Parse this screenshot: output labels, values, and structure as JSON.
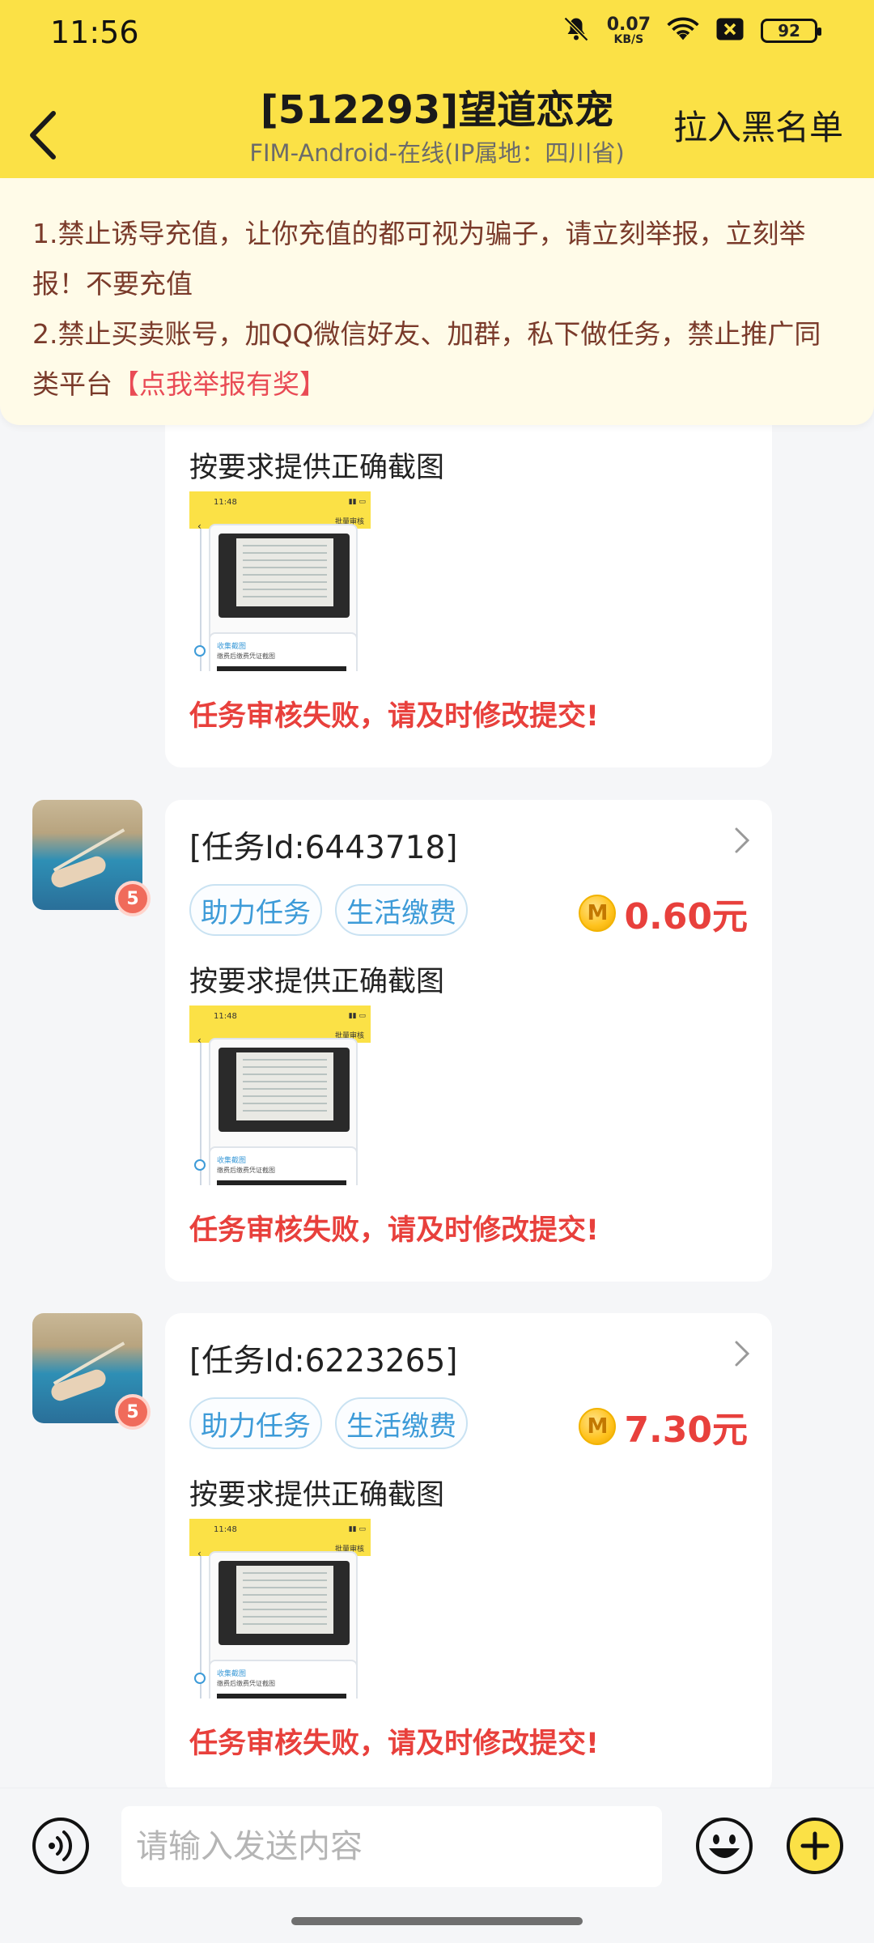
{
  "status_bar": {
    "time": "11:56",
    "net_speed": "0.07",
    "net_unit": "KB/S",
    "battery": "92"
  },
  "header": {
    "title": "[512293]望道恋宠",
    "subtitle": "FIM-Android-在线(IP属地：四川省)",
    "blacklist_label": "拉入黑名单"
  },
  "notice": {
    "line1": "1.禁止诱导充值，让你充值的都可视为骗子，请立刻举报，立刻举报！不要充值",
    "line2_prefix": "2.禁止买卖账号，加QQ微信好友、加群，私下做任务，禁止推广同类平台",
    "report_link": "【点我举报有奖】"
  },
  "messages": [
    {
      "instruction": "按要求提供正确截图",
      "status": "任务审核失败，请及时修改提交!"
    },
    {
      "task_id": "[任务Id:6443718]",
      "tags": [
        "助力任务",
        "生活缴费"
      ],
      "coin": "M",
      "reward": "0.60元",
      "instruction": "按要求提供正确截图",
      "status": "任务审核失败，请及时修改提交!",
      "level": "5"
    },
    {
      "task_id": "[任务Id:6223265]",
      "tags": [
        "助力任务",
        "生活缴费"
      ],
      "coin": "M",
      "reward": "7.30元",
      "instruction": "按要求提供正确截图",
      "status": "任务审核失败，请及时修改提交!",
      "level": "5"
    }
  ],
  "thumbnail": {
    "time": "11:48",
    "title": "批量审核",
    "card_title": "收集截图",
    "card_desc": "缴费后缴费凭证截图"
  },
  "input": {
    "placeholder": "请输入发送内容"
  },
  "colors": {
    "header_bg": "#fbe146",
    "notice_bg": "#fffbe8",
    "fail_text": "#e8403c",
    "tag_text": "#3d9bd8"
  }
}
